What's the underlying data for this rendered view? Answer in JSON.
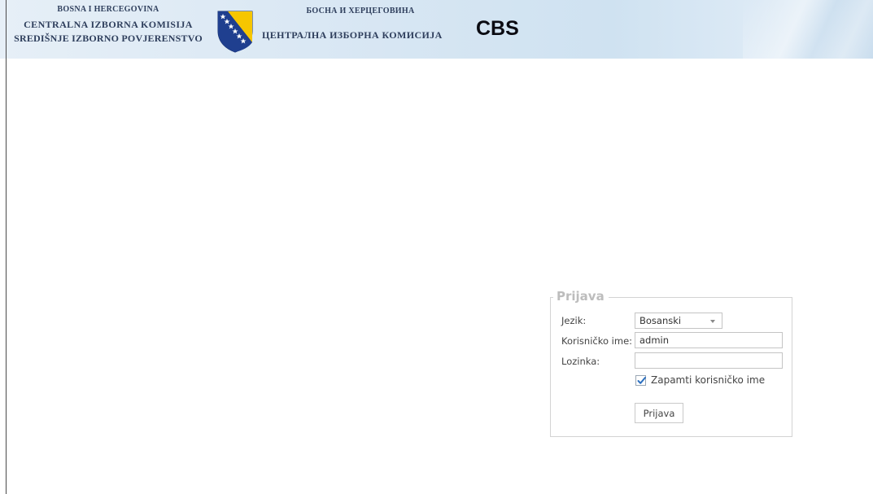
{
  "header": {
    "latin": {
      "line1": "BOSNA I HERCEGOVINA",
      "line2": "CENTRALNA IZBORNA KOMISIJA",
      "line3": "SREDIŠNJE IZBORNO POVJERENSTVO"
    },
    "cyrillic": {
      "line1": "БОСНА И ХЕРЦЕГОВИНА",
      "line2": "ЦЕНТРАЛНА ИЗБОРНА КОМИСИЈА"
    },
    "app_name": "CBS",
    "coat_of_arms": {
      "icon": "bih-coat-of-arms-icon",
      "colors": {
        "blue": "#1f3f8f",
        "yellow": "#f6c600",
        "star": "#ffffff"
      }
    }
  },
  "login": {
    "legend": "Prijava",
    "language_label": "Jezik:",
    "language_value": "Bosanski",
    "username_label": "Korisničko ime:",
    "username_value": "admin",
    "password_label": "Lozinka:",
    "password_value": "",
    "remember_label": "Zapamti korisničko ime",
    "remember_checked": true,
    "submit_label": "Prijava"
  },
  "colors": {
    "header_bg": "#d7e6f3",
    "header_text": "#2e3e5c",
    "legend_text": "#bdbdbd",
    "checkmark": "#2b6fbf"
  }
}
